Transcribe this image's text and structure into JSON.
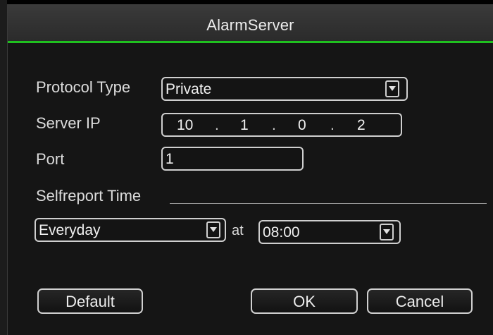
{
  "dialog": {
    "title": "AlarmServer"
  },
  "protocol_type": {
    "label": "Protocol Type",
    "value": "Private"
  },
  "server_ip": {
    "label": "Server IP",
    "octets": [
      "10",
      "1",
      "0",
      "2"
    ],
    "separator": "."
  },
  "port": {
    "label": "Port",
    "value": "1"
  },
  "selfreport": {
    "section_label": "Selfreport Time",
    "frequency": "Everyday",
    "at_label": "at",
    "time": "08:00"
  },
  "buttons": {
    "default_label": "Default",
    "ok_label": "OK",
    "cancel_label": "Cancel"
  },
  "colors": {
    "accent": "#1fc01f",
    "background": "#151515",
    "titlebar": "#333333",
    "border": "#cfcfcf"
  },
  "icons": {
    "dropdown": "chevron-down-icon"
  }
}
